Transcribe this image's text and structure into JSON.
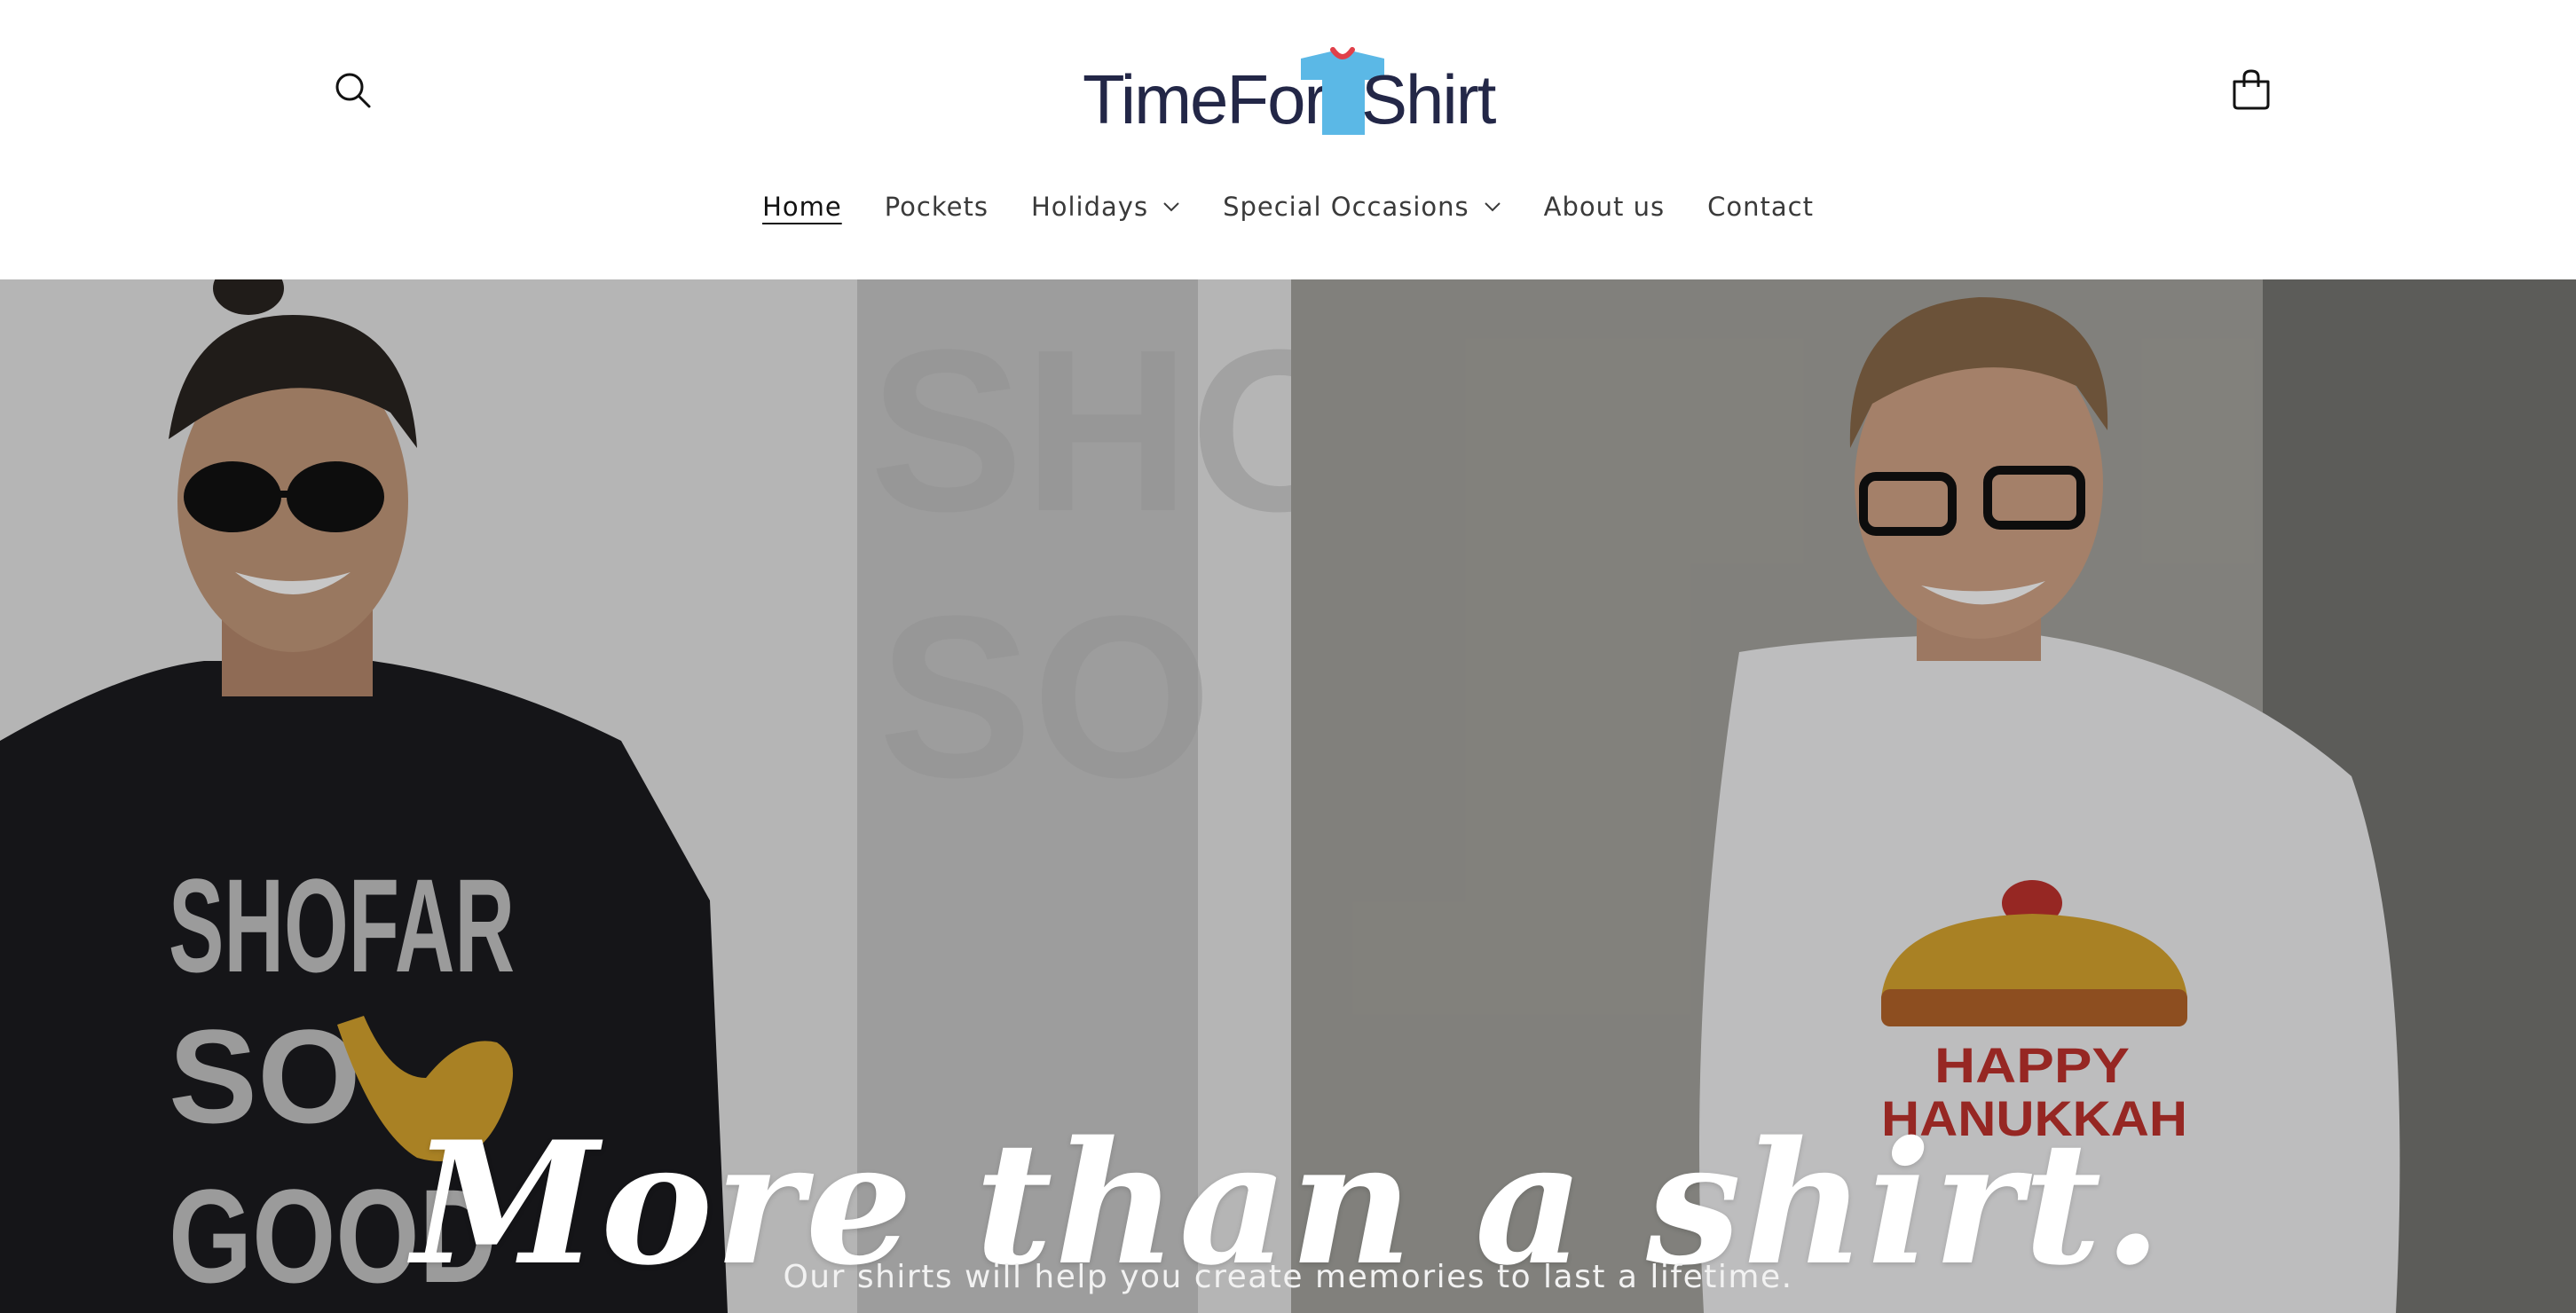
{
  "header": {
    "search_icon": "search-icon",
    "cart_icon": "cart-icon",
    "logo": {
      "part1": "TimeFor",
      "part2": "Shirt",
      "shirt_color": "#5bb8e6",
      "text_color": "#232747"
    }
  },
  "nav": {
    "items": [
      {
        "label": "Home",
        "active": true,
        "dropdown": false
      },
      {
        "label": "Pockets",
        "active": false,
        "dropdown": false
      },
      {
        "label": "Holidays",
        "active": false,
        "dropdown": true
      },
      {
        "label": "Special Occasions",
        "active": false,
        "dropdown": true
      },
      {
        "label": "About us",
        "active": false,
        "dropdown": false
      },
      {
        "label": "Contact",
        "active": false,
        "dropdown": false
      }
    ]
  },
  "hero": {
    "heading": "More than a shirt.",
    "subheading": "Our shirts will help you create memories to last a lifetime.",
    "left_shirt": {
      "line1": "SHOFAR",
      "line2": "SO",
      "line3": "GOOD"
    },
    "right_shirt": {
      "line1": "HAPPY",
      "line2": "HANUKKAH"
    },
    "bg_letters": {
      "line1": "SHO",
      "line2": "SO"
    }
  }
}
